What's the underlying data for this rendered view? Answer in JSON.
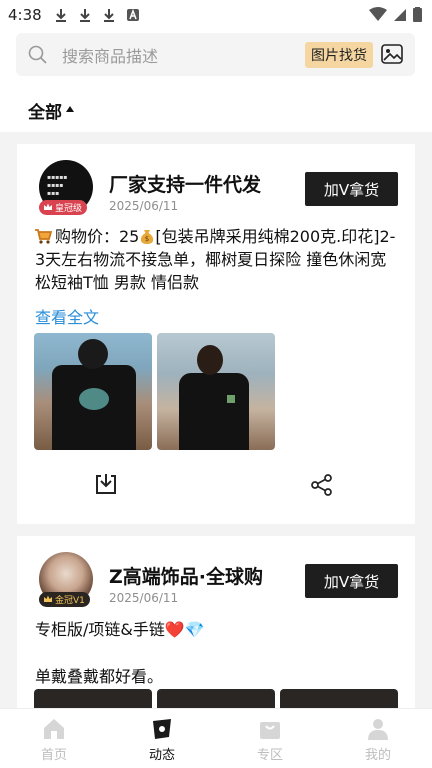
{
  "status_bar": {
    "time": "4:38"
  },
  "search": {
    "placeholder": "搜索商品描述",
    "image_search_label": "图片找货"
  },
  "filter": {
    "label": "全部"
  },
  "posts": [
    {
      "shop_name": "厂家支持一件代发",
      "badge": "皇冠级",
      "date": "2025/06/11",
      "add_button": "加V拿货",
      "text_prefix": "购物价：25",
      "text_body": "[包装吊牌采用纯棉200克.印花]2-3天左右物流不接急单，椰树夏日探险 撞色休闲宽松短袖T恤 男款 情侣款",
      "see_all": "查看全文"
    },
    {
      "shop_name": "Z高端饰品·全球购",
      "badge": "金冠V1",
      "date": "2025/06/11",
      "add_button": "加V拿货",
      "text_line1": "专柜版/项链&手链❤️💎",
      "text_line2": "单戴叠戴都好看。"
    }
  ],
  "tabs": [
    {
      "label": "首页",
      "icon": "home-icon"
    },
    {
      "label": "动态",
      "icon": "moments-icon"
    },
    {
      "label": "专区",
      "icon": "bag-icon"
    },
    {
      "label": "我的",
      "icon": "profile-icon"
    }
  ],
  "colors": {
    "accent_badge": "#f5d6a1",
    "link": "#2a8ed8",
    "button_dark": "#1e1e1e"
  }
}
